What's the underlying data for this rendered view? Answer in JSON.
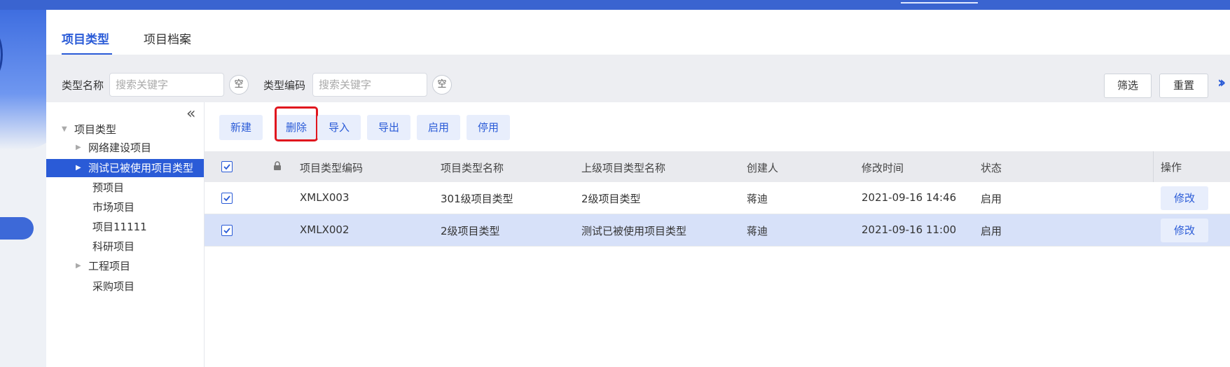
{
  "tabs": [
    {
      "label": "项目类型",
      "active": true
    },
    {
      "label": "项目档案",
      "active": false
    }
  ],
  "filters": [
    {
      "label": "类型名称",
      "placeholder": "搜索关键字",
      "clear_label": "空"
    },
    {
      "label": "类型编码",
      "placeholder": "搜索关键字",
      "clear_label": "空"
    }
  ],
  "filter_actions": {
    "filter_label": "筛选",
    "reset_label": "重置",
    "more_icon": "double-chevron-right-icon"
  },
  "tree": {
    "root": "项目类型",
    "nodes": [
      "网络建设项目",
      "测试已被使用项目类型",
      "预项目",
      "市场项目",
      "项目11111",
      "科研项目",
      "工程项目",
      "采购项目"
    ],
    "selected": "测试已被使用项目类型"
  },
  "toolbar": {
    "new_label": "新建",
    "delete_label": "删除",
    "import_label": "导入",
    "export_label": "导出",
    "enable_label": "启用",
    "disable_label": "停用"
  },
  "table": {
    "headers": [
      "项目类型编码",
      "项目类型名称",
      "上级项目类型名称",
      "创建人",
      "修改时间",
      "状态",
      "操作"
    ],
    "rows": [
      {
        "code": "XMLX003",
        "name": "301级项目类型",
        "parent": "2级项目类型",
        "creator": "蒋迪",
        "modified": "2021-09-16 14:46",
        "status": "启用",
        "action": "修改",
        "checked": true,
        "selected": false
      },
      {
        "code": "XMLX002",
        "name": "2级项目类型",
        "parent": "测试已被使用项目类型",
        "creator": "蒋迪",
        "modified": "2021-09-16 11:00",
        "status": "启用",
        "action": "修改",
        "checked": true,
        "selected": true
      }
    ]
  },
  "colors": {
    "accent": "#2a5bd7",
    "topbar": "#3a64d0",
    "selected_row": "#d7e1f9",
    "highlight": "#e0161e"
  }
}
